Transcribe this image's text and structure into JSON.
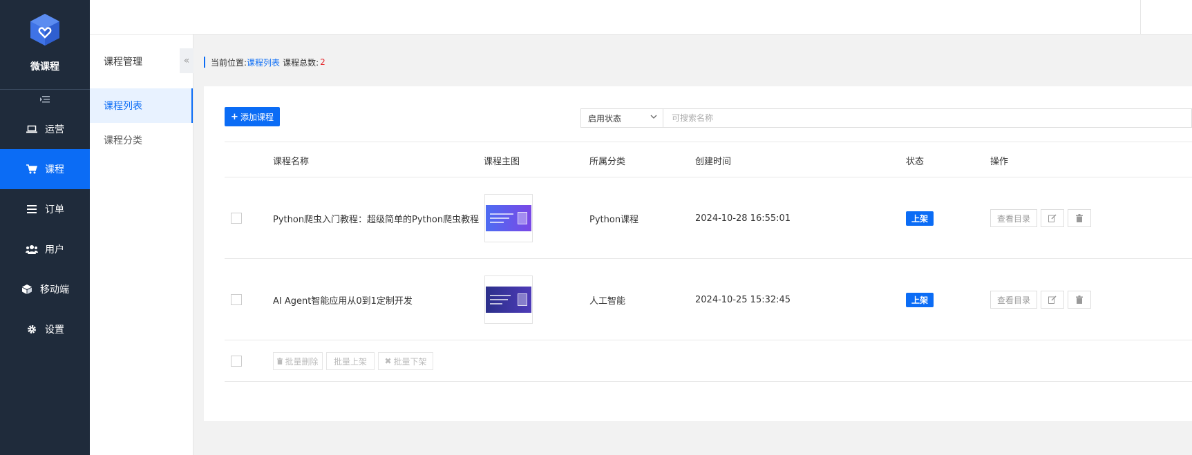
{
  "app": {
    "name": "微课程"
  },
  "colors": {
    "primary": "#0b6cf5",
    "sidebar_bg": "#1f2b3b",
    "danger": "#e5262a"
  },
  "sidebar": {
    "items": [
      {
        "label": "运营",
        "icon": "laptop-icon"
      },
      {
        "label": "课程",
        "icon": "cart-icon",
        "active": true
      },
      {
        "label": "订单",
        "icon": "list-icon"
      },
      {
        "label": "用户",
        "icon": "users-icon"
      },
      {
        "label": "移动端",
        "icon": "cube-icon"
      },
      {
        "label": "设置",
        "icon": "gear-icon"
      }
    ]
  },
  "subnav": {
    "title": "课程管理",
    "collapse_icon": "«",
    "items": [
      {
        "label": "课程列表",
        "active": true
      },
      {
        "label": "课程分类"
      }
    ]
  },
  "breadcrumb": {
    "prefix": "当前位置:",
    "current": "课程列表",
    "total_label": "课程总数:",
    "total": "2"
  },
  "toolbar": {
    "add_label": "添加课程",
    "status_select": "启用状态",
    "search_placeholder": "可搜索名称"
  },
  "table": {
    "columns": [
      "课程名称",
      "课程主图",
      "所属分类",
      "创建时间",
      "状态",
      "操作"
    ],
    "rows": [
      {
        "name": "Python爬虫入门教程：超级简单的Python爬虫教程",
        "category": "Python课程",
        "created": "2024-10-28 16:55:01",
        "status": "上架",
        "view_label": "查看目录"
      },
      {
        "name": "AI Agent智能应用从0到1定制开发",
        "category": "人工智能",
        "created": "2024-10-25 15:32:45",
        "status": "上架",
        "view_label": "查看目录"
      }
    ]
  },
  "bulk": {
    "delete_label": "批量删除",
    "up_label": "批量上架",
    "down_label": "批量下架"
  }
}
